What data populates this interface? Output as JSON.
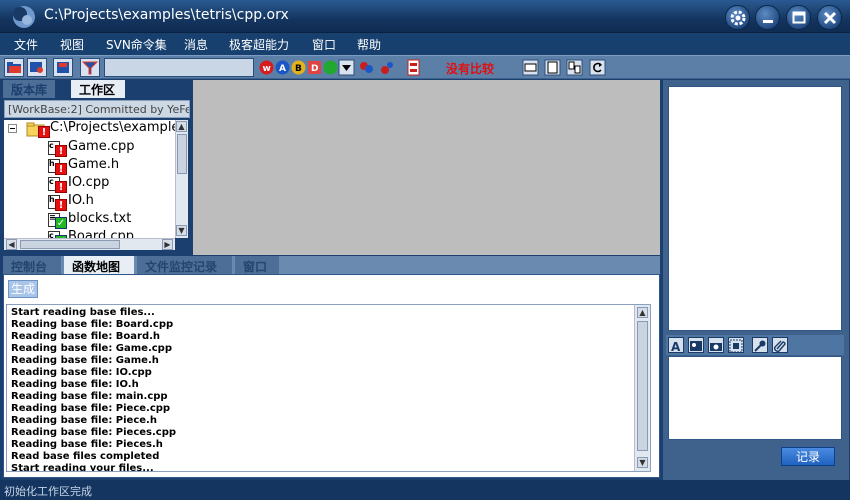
{
  "window": {
    "title": "C:\\Projects\\examples\\tetris\\cpp.orx"
  },
  "window_controls": [
    "settings",
    "minimize",
    "maximize",
    "close"
  ],
  "menu": [
    "文件",
    "视图",
    "SVN命令集",
    "消息",
    "极客超能力",
    "窗口",
    "帮助"
  ],
  "toolbar": {
    "status_label": "没有比较",
    "status_color": "#e01010"
  },
  "left_panel": {
    "tabs": [
      "版本库",
      "工作区"
    ],
    "active_tab": "工作区",
    "commit_line": "[WorkBase:2] Committed by YeFe...",
    "tree": {
      "root": "C:\\Projects\\examples",
      "files": [
        {
          "name": "Game.cpp",
          "type": "c",
          "state": "error"
        },
        {
          "name": "Game.h",
          "type": "h",
          "state": "error"
        },
        {
          "name": "IO.cpp",
          "type": "c",
          "state": "error"
        },
        {
          "name": "IO.h",
          "type": "h",
          "state": "error"
        },
        {
          "name": "blocks.txt",
          "type": "txt",
          "state": "ok"
        },
        {
          "name": "Board.cpp",
          "type": "c",
          "state": "ok"
        }
      ]
    }
  },
  "bottom_panel": {
    "tabs": [
      "控制台",
      "函数地图",
      "文件监控记录",
      "窗口"
    ],
    "active_tab": "函数地图",
    "generate_label": "生成",
    "log": [
      "Start reading base files...",
      "Reading base file: Board.cpp",
      "Reading base file: Board.h",
      "Reading base file: Game.cpp",
      "Reading base file: Game.h",
      "Reading base file: IO.cpp",
      "Reading base file: IO.h",
      "Reading base file: main.cpp",
      "Reading base file: Piece.cpp",
      "Reading base file: Piece.h",
      "Reading base file: Pieces.cpp",
      "Reading base file: Pieces.h",
      "Read base files completed",
      "Start reading your files..."
    ]
  },
  "right_panel": {
    "record_label": "记录"
  },
  "status": {
    "text": "初始化工作区完成"
  }
}
